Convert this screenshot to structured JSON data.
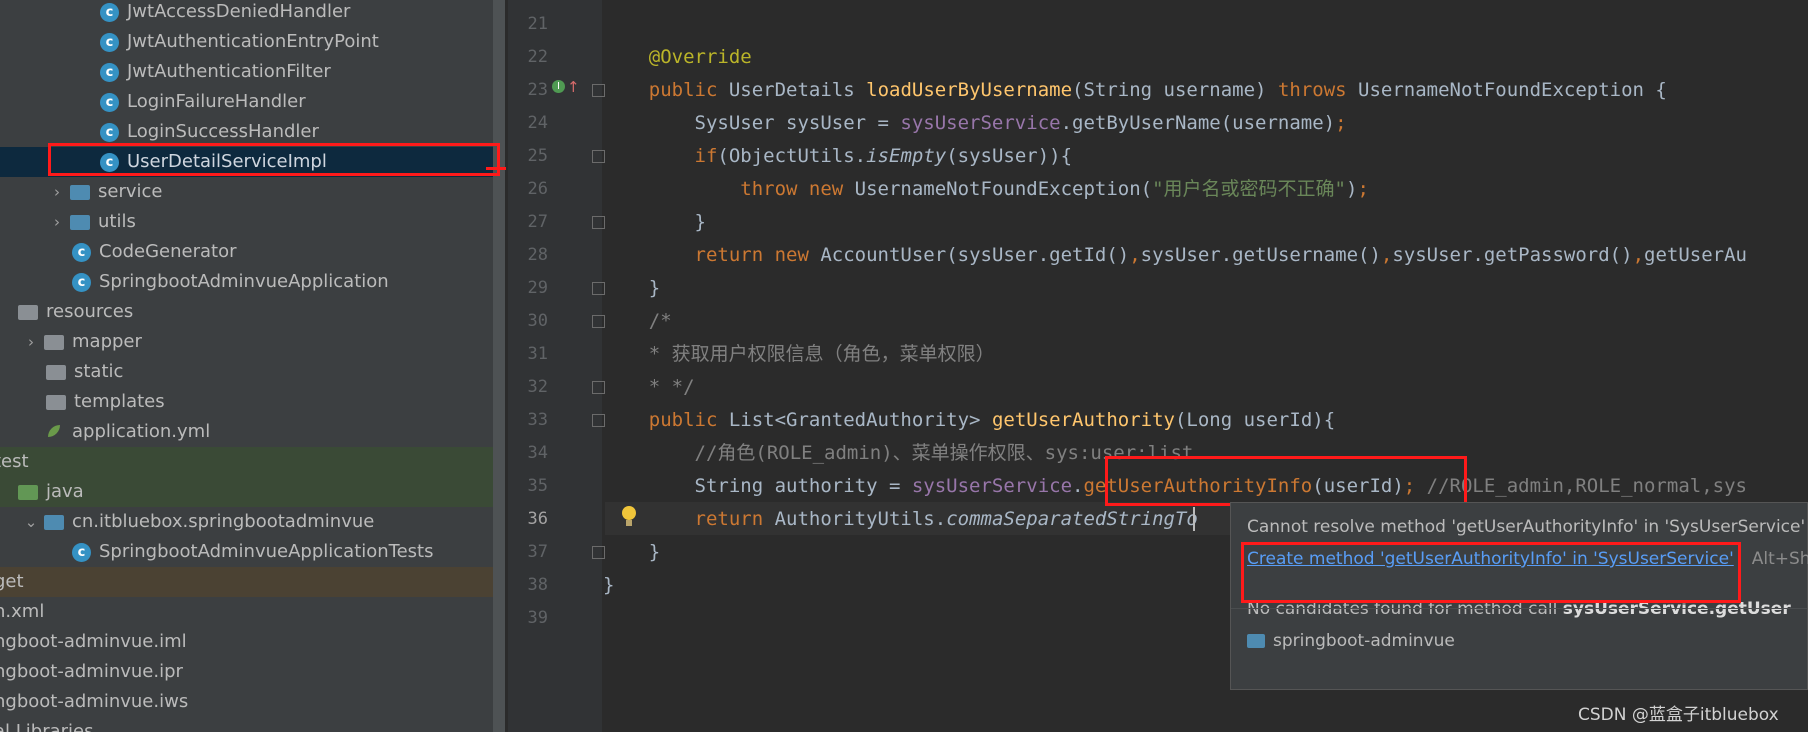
{
  "project_tree": {
    "rows": [
      {
        "label": "JwtAccessDeniedHandler",
        "icon": "class-icon",
        "indent": 3,
        "style": ""
      },
      {
        "label": "JwtAuthenticationEntryPoint",
        "icon": "class-icon",
        "indent": 3,
        "style": ""
      },
      {
        "label": "JwtAuthenticationFilter",
        "icon": "class-icon",
        "indent": 3,
        "style": ""
      },
      {
        "label": "LoginFailureHandler",
        "icon": "class-icon",
        "indent": 3,
        "style": ""
      },
      {
        "label": "LoginSuccessHandler",
        "icon": "class-icon",
        "indent": 3,
        "style": ""
      },
      {
        "label": "UserDetailServiceImpl",
        "icon": "class-icon",
        "indent": 3,
        "style": "sel"
      },
      {
        "label": "service",
        "icon": "package-folder-icon",
        "indent": 2,
        "style": "",
        "arrow": "›"
      },
      {
        "label": "utils",
        "icon": "package-folder-icon",
        "indent": 2,
        "style": "",
        "arrow": "›"
      },
      {
        "label": "CodeGenerator",
        "icon": "class-icon",
        "indent": 2,
        "style": ""
      },
      {
        "label": "SpringbootAdminvueApplication",
        "icon": "spring-class-icon",
        "indent": 2,
        "style": ""
      },
      {
        "label": "resources",
        "icon": "resources-folder-icon",
        "indent": 0,
        "style": ""
      },
      {
        "label": "mapper",
        "icon": "folder-icon",
        "indent": 1,
        "style": "",
        "arrow": "›"
      },
      {
        "label": "static",
        "icon": "folder-icon",
        "indent": 1,
        "style": ""
      },
      {
        "label": "templates",
        "icon": "folder-icon",
        "indent": 1,
        "style": ""
      },
      {
        "label": "application.yml",
        "icon": "spring-config-icon",
        "indent": 1,
        "style": ""
      },
      {
        "label": "test",
        "icon": "",
        "indent": -1,
        "style": "green"
      },
      {
        "label": "java",
        "icon": "test-folder-icon",
        "indent": 0,
        "style": "green"
      },
      {
        "label": "cn.itbluebox.springbootadminvue",
        "icon": "package-folder-icon",
        "indent": 1,
        "style": "",
        "arrow": "⌄"
      },
      {
        "label": "SpringbootAdminvueApplicationTests",
        "icon": "spring-class-icon",
        "indent": 2,
        "style": ""
      },
      {
        "label": "get",
        "icon": "",
        "indent": -1,
        "style": "brown"
      },
      {
        "label": "n.xml",
        "icon": "",
        "indent": -1,
        "style": ""
      },
      {
        "label": "ngboot-adminvue.iml",
        "icon": "",
        "indent": -1,
        "style": ""
      },
      {
        "label": "ngboot-adminvue.ipr",
        "icon": "",
        "indent": -1,
        "style": ""
      },
      {
        "label": "ngboot-adminvue.iws",
        "icon": "",
        "indent": -1,
        "style": ""
      },
      {
        "label": "al Libraries",
        "icon": "",
        "indent": -1,
        "style": ""
      }
    ]
  },
  "editor": {
    "line_numbers": [
      "21",
      "22",
      "23",
      "24",
      "25",
      "26",
      "27",
      "28",
      "29",
      "30",
      "31",
      "32",
      "33",
      "34",
      "35",
      "36",
      "37",
      "38",
      "39"
    ],
    "current_line": "36",
    "lines": [
      [],
      [
        {
          "t": "    "
        },
        {
          "t": "@Override",
          "c": "ann"
        }
      ],
      [
        {
          "t": "    "
        },
        {
          "t": "public ",
          "c": "kw"
        },
        {
          "t": "UserDetails "
        },
        {
          "t": "loadUserByUsername",
          "c": "fn"
        },
        {
          "t": "(String username) "
        },
        {
          "t": "throws ",
          "c": "kw"
        },
        {
          "t": "UsernameNotFoundException {"
        }
      ],
      [
        {
          "t": "        SysUser sysUser = "
        },
        {
          "t": "sysUserService",
          "c": "fld"
        },
        {
          "t": ".getByUserName(username)"
        },
        {
          "t": ";",
          "c": "kw"
        }
      ],
      [
        {
          "t": "        "
        },
        {
          "t": "if",
          "c": "kw"
        },
        {
          "t": "(ObjectUtils."
        },
        {
          "t": "isEmpty",
          "c": "sit"
        },
        {
          "t": "(sysUser)){"
        }
      ],
      [
        {
          "t": "            "
        },
        {
          "t": "throw new ",
          "c": "kw"
        },
        {
          "t": "UsernameNotFoundException("
        },
        {
          "t": "\"用户名或密码不正确\"",
          "c": "str"
        },
        {
          "t": ")"
        },
        {
          "t": ";",
          "c": "kw"
        }
      ],
      [
        {
          "t": "        }"
        }
      ],
      [
        {
          "t": "        "
        },
        {
          "t": "return new ",
          "c": "kw"
        },
        {
          "t": "AccountUser(sysUser.getId()"
        },
        {
          "t": ",",
          "c": "kw"
        },
        {
          "t": "sysUser.getUsername()"
        },
        {
          "t": ",",
          "c": "kw"
        },
        {
          "t": "sysUser.getPassword()"
        },
        {
          "t": ",",
          "c": "kw"
        },
        {
          "t": "getUserAu"
        }
      ],
      [
        {
          "t": "    }"
        }
      ],
      [
        {
          "t": "    "
        },
        {
          "t": "/*",
          "c": "cmt"
        }
      ],
      [
        {
          "t": "    "
        },
        {
          "t": "* 获取用户权限信息（角色，菜单权限）",
          "c": "cmt"
        }
      ],
      [
        {
          "t": "    "
        },
        {
          "t": "* */",
          "c": "cmt"
        }
      ],
      [
        {
          "t": "    "
        },
        {
          "t": "public ",
          "c": "kw"
        },
        {
          "t": "List<GrantedAuthority> "
        },
        {
          "t": "getUserAuthority",
          "c": "fn"
        },
        {
          "t": "(Long userId){"
        }
      ],
      [
        {
          "t": "        "
        },
        {
          "t": "//角色(ROLE_admin)、菜单操作权限、sys:user:list",
          "c": "cmt"
        }
      ],
      [
        {
          "t": "        String authority = "
        },
        {
          "t": "sysUserService",
          "c": "fld"
        },
        {
          "t": "."
        },
        {
          "t": "getUserAuthorityInfo",
          "c": "kw"
        },
        {
          "t": "(userId)"
        },
        {
          "t": "; ",
          "c": "kw"
        },
        {
          "t": "//ROLE_admin,ROLE_normal,sys",
          "c": "cmt"
        }
      ],
      [
        {
          "t": "        "
        },
        {
          "t": "return ",
          "c": "kw"
        },
        {
          "t": "AuthorityUtils."
        },
        {
          "t": "commaSeparatedStringTo",
          "c": "sit"
        }
      ],
      [
        {
          "t": "    }"
        }
      ],
      [
        {
          "t": "}"
        }
      ],
      []
    ]
  },
  "popup": {
    "error_message": "Cannot resolve method 'getUserAuthorityInfo' in 'SysUserService'",
    "action_label": "Create method 'getUserAuthorityInfo' in 'SysUserService'",
    "action_shortcut": "Alt+Sh",
    "no_candidates_prefix": "No candidates found for method call ",
    "no_candidates_bold": "sysUserService.getUser",
    "module_label": "springboot-adminvue"
  },
  "watermark": "CSDN @蓝盒子itbluebox",
  "colors": {
    "highlight_red": "#ff1a1a",
    "link_blue": "#589df6",
    "keyword": "#cc7832"
  }
}
